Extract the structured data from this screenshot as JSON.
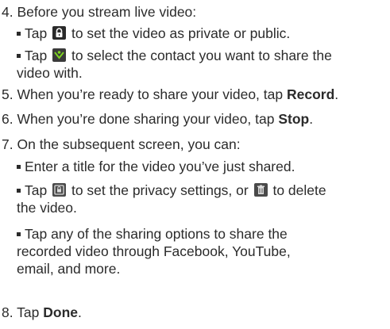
{
  "steps": {
    "s4": {
      "num": "4.",
      "text": "Before you stream live video:"
    },
    "s4_b1": {
      "pre": "Tap",
      "post": "to set the video as private or public.",
      "icon": "lock-icon"
    },
    "s4_b2": {
      "pre": "Tap",
      "post": "to select the contact you want to share the",
      "post2": "video with.",
      "icon": "contact-select-icon"
    },
    "s5": {
      "num": "5.",
      "pre": "When you’re ready to share your video, tap",
      "kw": "Record",
      "post": "."
    },
    "s6": {
      "num": "6.",
      "pre": "When you’re done sharing your video, tap",
      "kw": "Stop",
      "post": "."
    },
    "s7": {
      "num": "7.",
      "text": "On the subsequent screen, you can:"
    },
    "s7_b1": {
      "text": "Enter a title for the video you’ve just shared."
    },
    "s7_b2": {
      "pre": "Tap",
      "mid": "to set the privacy settings, or",
      "post": "to delete",
      "post2": "the video.",
      "icon1": "privacy-icon",
      "icon2": "delete-icon"
    },
    "s7_b3": {
      "line1": "Tap any of the sharing options to share the",
      "line2": "recorded video through Facebook, YouTube,",
      "line3": "email, and more."
    },
    "s8": {
      "num": "8.",
      "pre": "Tap",
      "kw": "Done",
      "post": "."
    }
  }
}
